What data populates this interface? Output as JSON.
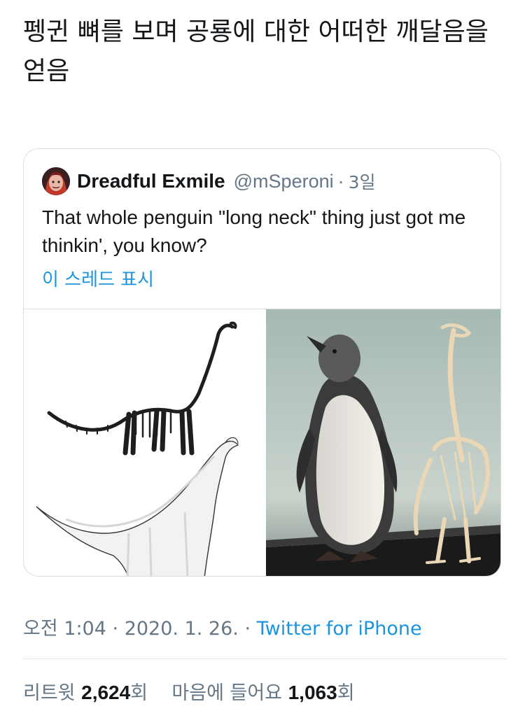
{
  "tweet": {
    "text": "펭귄 뼈를 보며 공룡에 대한 어떠한 깨달음을 얻음"
  },
  "quoted": {
    "display_name": "Dreadful Exmile",
    "handle": "@mSperoni",
    "separator": "·",
    "age": "3일",
    "text": "That whole penguin \"long neck\" thing just got me thinkin', you know?",
    "thread_link": "이 스레드 표시",
    "media": [
      {
        "icon": "sauropod-skeleton-illustration"
      },
      {
        "icon": "penguin-and-skeleton-photo"
      }
    ]
  },
  "meta": {
    "time": "오전 1:04",
    "separator": "·",
    "date": "2020. 1. 26.",
    "source": "Twitter for iPhone"
  },
  "stats": {
    "retweets_label": "리트윗",
    "retweets_count": "2,624",
    "retweets_unit": "회",
    "likes_label": "마음에 들어요",
    "likes_count": "1,063",
    "likes_unit": "회"
  },
  "colors": {
    "link": "#1b95e0",
    "secondary": "#657786",
    "border": "#d6dde3"
  }
}
